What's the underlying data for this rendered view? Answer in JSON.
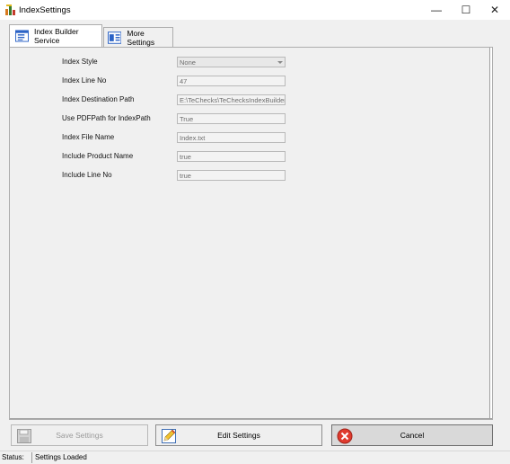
{
  "window": {
    "title": "IndexSettings",
    "minimize_glyph": "—",
    "maximize_glyph": "☐",
    "close_glyph": "✕"
  },
  "tabs": [
    {
      "label": "Index Builder Service",
      "icon": "form-icon",
      "active": true
    },
    {
      "label": "More Settings",
      "icon": "settings-card-icon",
      "active": false
    }
  ],
  "form": {
    "fields": [
      {
        "label": "Index Style",
        "value": "None",
        "kind": "select"
      },
      {
        "label": "Index Line No",
        "value": "47",
        "kind": "text"
      },
      {
        "label": "Index Destination Path",
        "value": "E:\\TeChecks\\TeChecksIndexBuilder\\",
        "kind": "text"
      },
      {
        "label": "Use PDFPath for IndexPath",
        "value": "True",
        "kind": "text"
      },
      {
        "label": "Index File Name",
        "value": "Index.txt",
        "kind": "text"
      },
      {
        "label": "Include Product Name",
        "value": "true",
        "kind": "text"
      },
      {
        "label": "Include Line No",
        "value": "true",
        "kind": "text"
      }
    ]
  },
  "buttons": {
    "save": {
      "label": "Save Settings",
      "icon": "floppy-disk-icon",
      "enabled": false
    },
    "edit": {
      "label": "Edit Settings",
      "icon": "pencil-edit-icon",
      "enabled": true
    },
    "cancel": {
      "label": "Cancel",
      "icon": "red-x-icon",
      "enabled": true
    }
  },
  "status": {
    "label": "Status:",
    "value": "Settings Loaded"
  },
  "colors": {
    "cancel_icon": "#e03b2e",
    "tab_icon_blue": "#2b63c6"
  }
}
